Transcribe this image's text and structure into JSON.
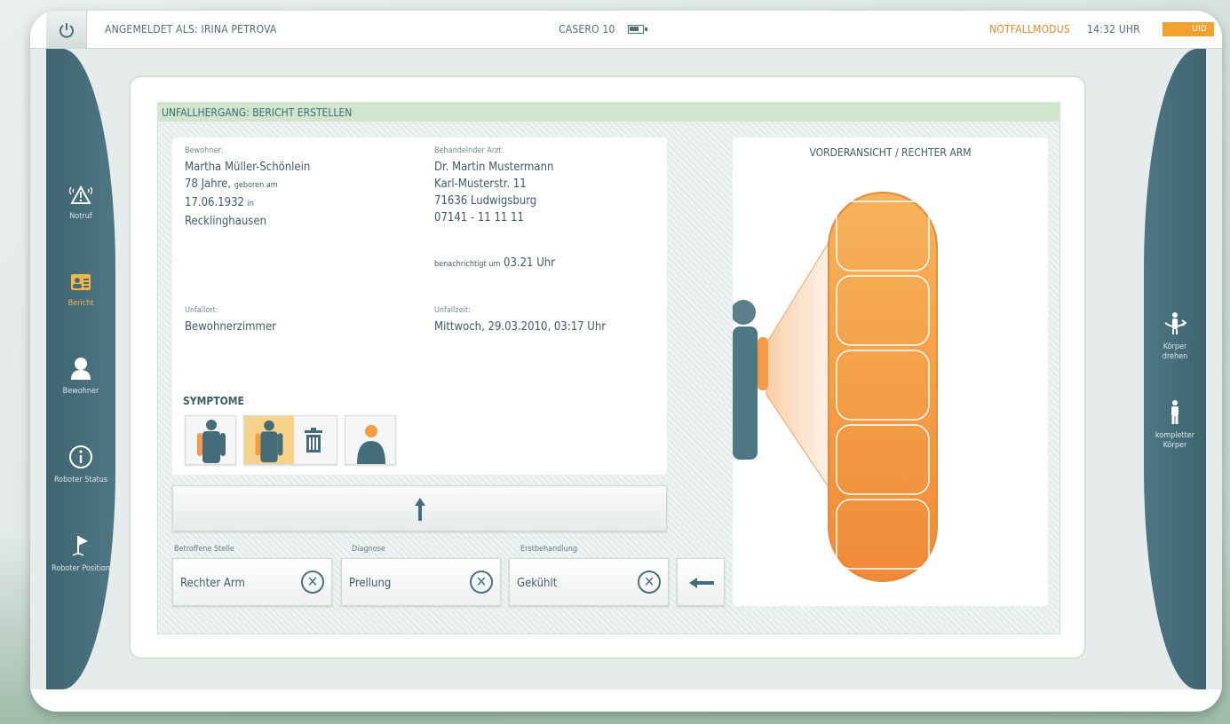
{
  "topbar": {
    "logged_in": "ANGEMELDET ALS: IRINA PETROVA",
    "device": "CASERO 10",
    "mode": "NOTFALLMODUS",
    "time": "14:32 UHR",
    "uid": "UID"
  },
  "nav_left": [
    {
      "label": "Notruf",
      "icon": "warning-icon"
    },
    {
      "label": "Bericht",
      "icon": "id-card-icon",
      "active": true
    },
    {
      "label": "Bewohner",
      "icon": "person-icon"
    },
    {
      "label": "Roboter Status",
      "icon": "info-icon"
    },
    {
      "label": "Roboter Position",
      "icon": "flag-icon"
    }
  ],
  "nav_right": [
    {
      "label": "Körper drehen",
      "icon": "rotate-body-icon"
    },
    {
      "label": "kompletter Körper",
      "icon": "full-body-icon"
    }
  ],
  "panel": {
    "title": "UNFALLHERGANG: BERICHT ERSTELLEN"
  },
  "resident": {
    "label": "Bewohner:",
    "name": "Martha Müller-Schönlein",
    "age": "78 Jahre,",
    "born_label": "geboren am",
    "birthdate": "17.06.1932",
    "born_in_label": "in",
    "birthplace": "Recklinghausen"
  },
  "doctor": {
    "label": "Behandelnder Arzt:",
    "name": "Dr. Martin Mustermann",
    "street": "Karl-Musterstr. 11",
    "city": "71636 Ludwigsburg",
    "phone": "07141 - 11 11 11",
    "notified_label": "benachrichtigt um",
    "notified_time": "03.21 Uhr"
  },
  "accident": {
    "location_label": "Unfallort:",
    "location": "Bewohnerzimmer",
    "time_label": "Unfallzeit:",
    "time": "Mittwoch, 29.03.2010, 03:17 Uhr"
  },
  "symptoms": {
    "title": "SYMPTOME"
  },
  "fields": [
    {
      "label": "Betroffene Stelle",
      "value": "Rechter Arm"
    },
    {
      "label": "Diagnose",
      "value": "Prellung"
    },
    {
      "label": "Erstbehandlung",
      "value": "Gekühlt"
    }
  ],
  "view": {
    "title": "VORDERANSICHT / RECHTER ARM",
    "arm_segments": 5
  },
  "colors": {
    "accent": "#f2a12e",
    "sidebar": "#456d79",
    "arm_orange": "#f59a45",
    "text": "#3d5c66"
  }
}
